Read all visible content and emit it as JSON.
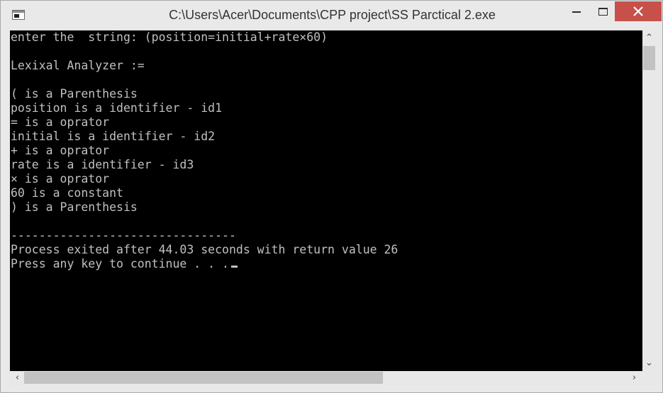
{
  "window": {
    "title": "C:\\Users\\Acer\\Documents\\CPP project\\SS Parctical 2.exe"
  },
  "console": {
    "lines": [
      "enter the  string: (position=initial+rate×60)",
      "",
      "Lexixal Analyzer :=",
      "",
      "( is a Parenthesis",
      "position is a identifier - id1",
      "= is a oprator",
      "initial is a identifier - id2",
      "+ is a oprator",
      "rate is a identifier - id3",
      "× is a oprator",
      "60 is a constant",
      ") is a Parenthesis",
      "",
      "--------------------------------",
      "Process exited after 44.03 seconds with return value 26",
      "Press any key to continue . . ."
    ]
  },
  "icons": {
    "app": "console-app-icon",
    "minimize": "minimize-icon",
    "maximize": "maximize-icon",
    "close": "close-icon",
    "scroll_up": "arrow-up-icon",
    "scroll_down": "arrow-down-icon",
    "scroll_left": "arrow-left-icon",
    "scroll_right": "arrow-right-icon"
  },
  "colors": {
    "console_background": "#000000",
    "console_text": "#c0c0c0",
    "close_button": "#c7514a",
    "chrome": "#e9e9e9"
  }
}
